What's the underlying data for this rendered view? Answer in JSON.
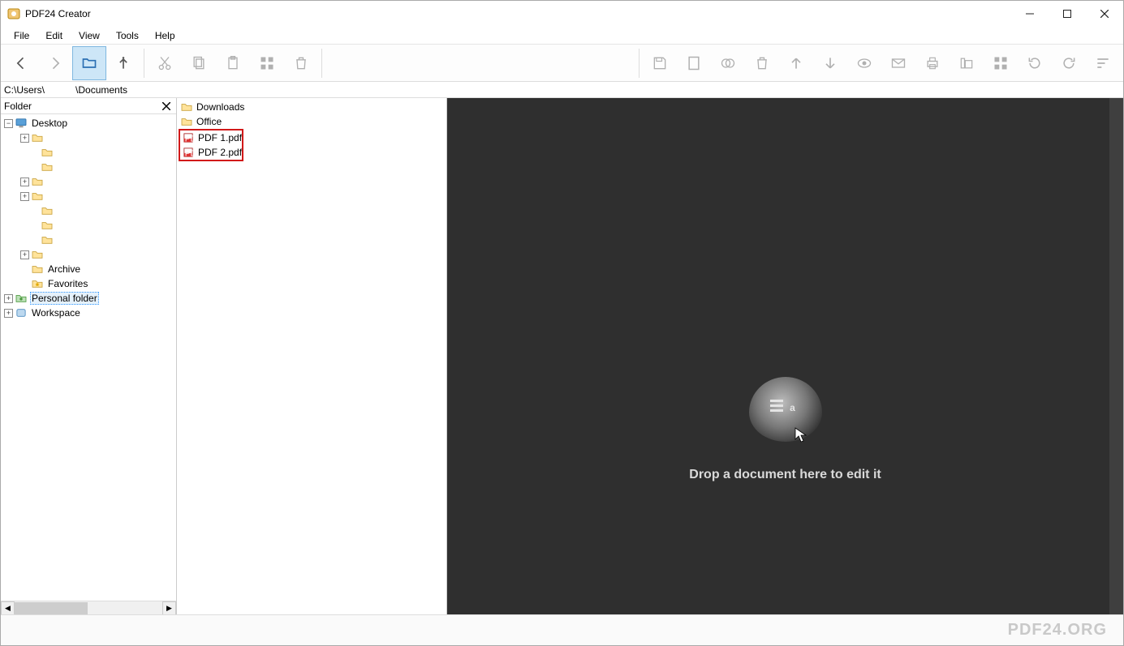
{
  "window": {
    "title": "PDF24 Creator"
  },
  "menubar": {
    "items": [
      "File",
      "Edit",
      "View",
      "Tools",
      "Help"
    ]
  },
  "path": {
    "left": "C:\\Users\\",
    "right": "\\Documents"
  },
  "tree": {
    "header": "Folder",
    "root": {
      "label": "Desktop",
      "children_unnamed_count": 8,
      "named_children": [
        {
          "label": "Archive",
          "icon": "folder"
        },
        {
          "label": "Favorites",
          "icon": "star-folder"
        },
        {
          "label": "Personal folder",
          "icon": "personal",
          "selected": true,
          "expandable": true
        },
        {
          "label": "Workspace",
          "icon": "workspace",
          "expandable": true
        }
      ]
    }
  },
  "file_list": {
    "folders": [
      "Downloads",
      "Office"
    ],
    "files": [
      "PDF 1.pdf",
      "PDF 2.pdf"
    ]
  },
  "preview": {
    "drop_text": "Drop a document here to edit it"
  },
  "branding": {
    "text": "PDF24.ORG"
  }
}
